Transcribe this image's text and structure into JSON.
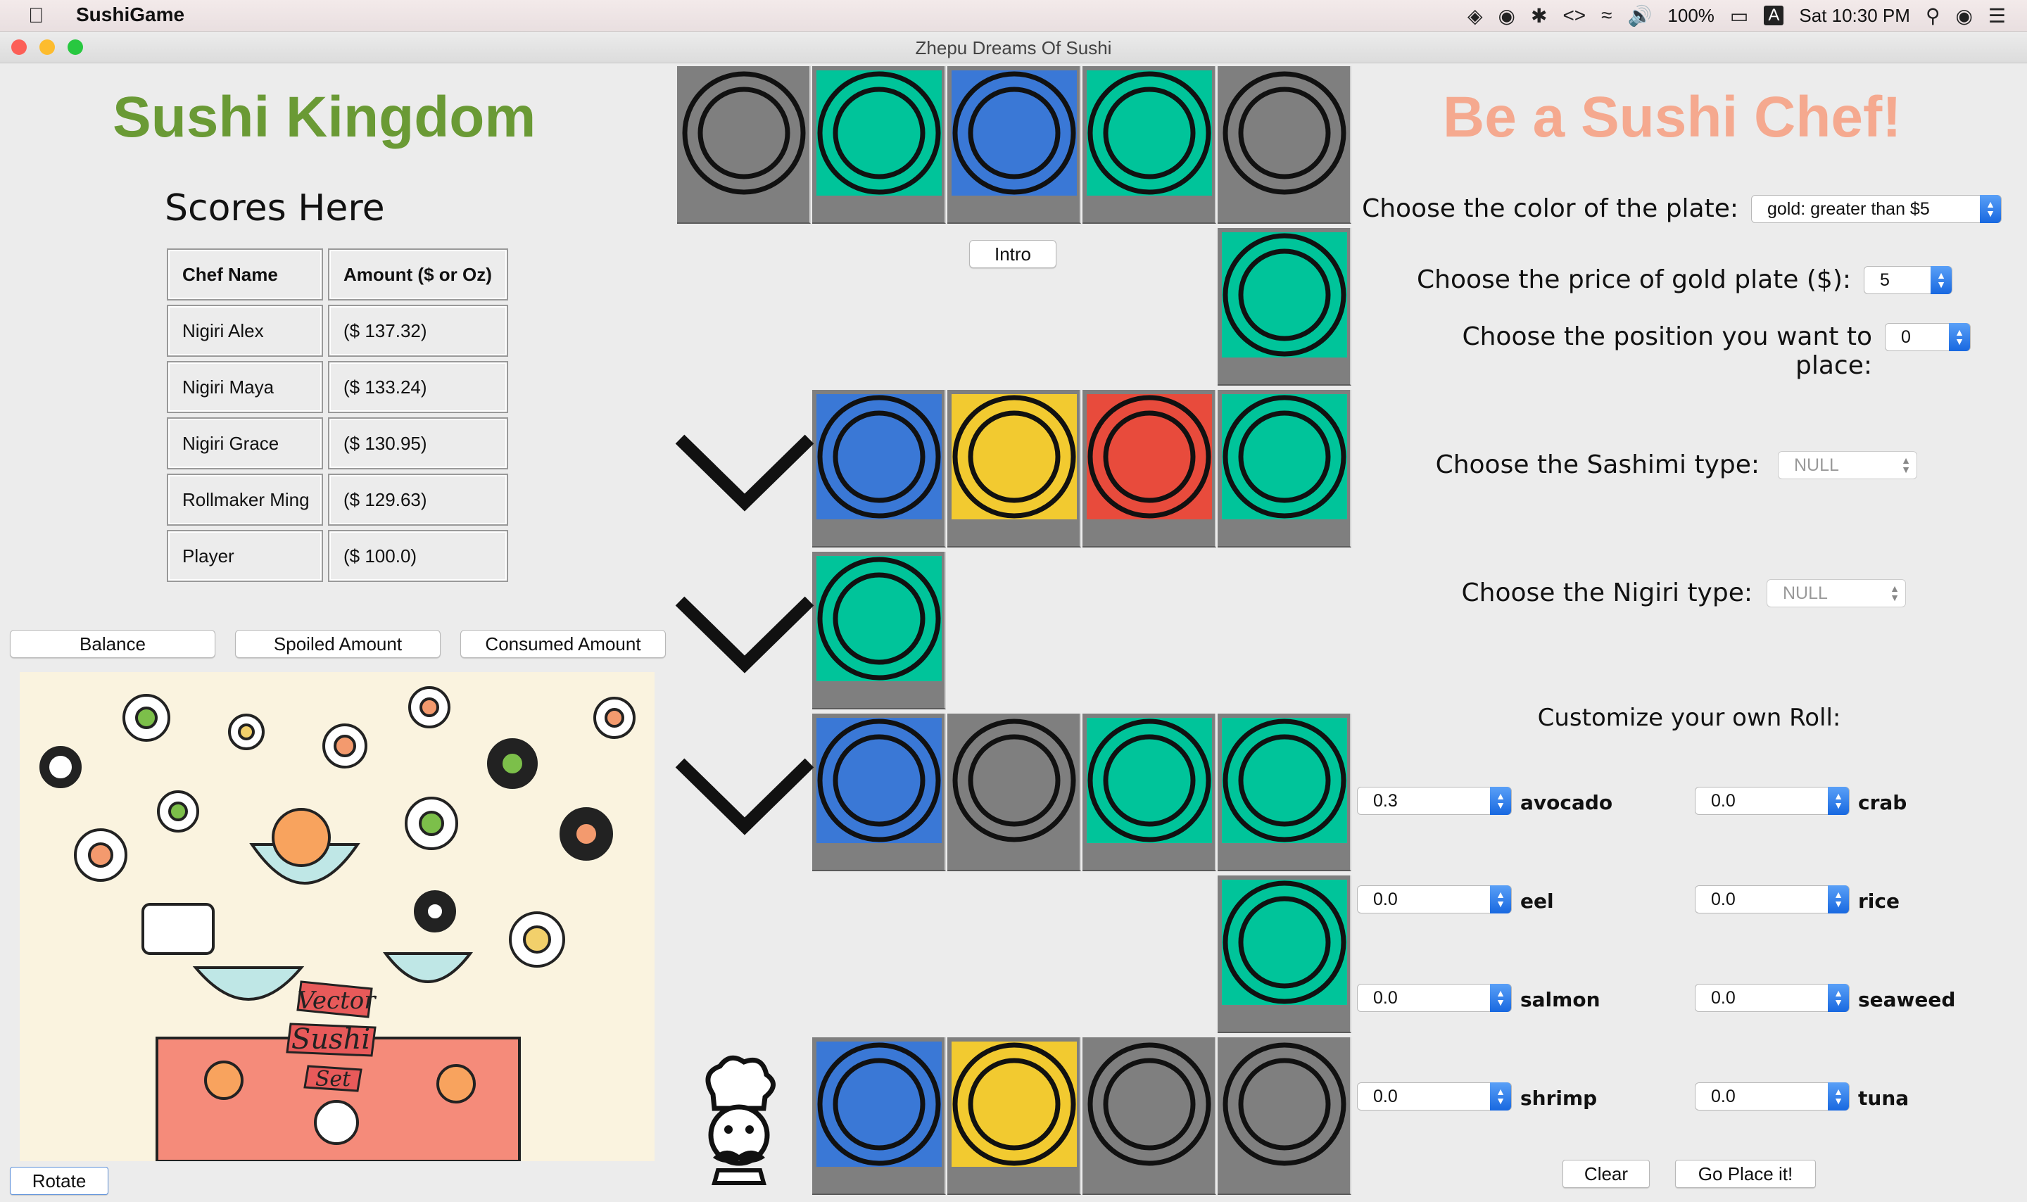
{
  "menubar": {
    "app_name": "SushiGame",
    "battery": "100%",
    "input_source": "A",
    "clock": "Sat 10:30 PM"
  },
  "window": {
    "title": "Zhepu Dreams Of Sushi"
  },
  "left": {
    "title": "Sushi Kingdom",
    "scores_title": "Scores Here",
    "table": {
      "headers": [
        "Chef Name",
        "Amount ($ or Oz)"
      ],
      "rows": [
        [
          "Nigiri Alex",
          "($ 137.32)"
        ],
        [
          "Nigiri Maya",
          "($ 133.24)"
        ],
        [
          "Nigiri Grace",
          "($ 130.95)"
        ],
        [
          "Rollmaker Ming",
          "($ 129.63)"
        ],
        [
          "Player",
          "($ 100.0)"
        ]
      ]
    },
    "buttons": {
      "balance": "Balance",
      "spoiled": "Spoiled Amount",
      "consumed": "Consumed Amount",
      "rotate": "Rotate"
    },
    "poster": {
      "line1": "Vector",
      "line2": "Sushi",
      "line3": "Set"
    }
  },
  "belt": {
    "intro_button": "Intro"
  },
  "colors": {
    "gray": "#7f7f7f",
    "green": "#00c49a",
    "blue": "#3a78d6",
    "yellow": "#f2ca30",
    "red": "#e84b3c"
  },
  "right": {
    "title": "Be a Sushi Chef!",
    "plate_color": {
      "label": "Choose the color of the plate:",
      "value": "gold: greater than $5"
    },
    "plate_price": {
      "label": "Choose the price of gold plate ($):",
      "value": "5"
    },
    "position": {
      "label": "Choose the position you want to place:",
      "value": "0"
    },
    "sashimi": {
      "label": "Choose the Sashimi type:",
      "value": "NULL"
    },
    "nigiri": {
      "label": "Choose the Nigiri type:",
      "value": "NULL"
    },
    "roll": {
      "title": "Customize your own Roll:",
      "ingredients": [
        {
          "name": "avocado",
          "value": "0.3"
        },
        {
          "name": "crab",
          "value": "0.0"
        },
        {
          "name": "eel",
          "value": "0.0"
        },
        {
          "name": "rice",
          "value": "0.0"
        },
        {
          "name": "salmon",
          "value": "0.0"
        },
        {
          "name": "seaweed",
          "value": "0.0"
        },
        {
          "name": "shrimp",
          "value": "0.0"
        },
        {
          "name": "tuna",
          "value": "0.0"
        }
      ]
    },
    "buttons": {
      "clear": "Clear",
      "place": "Go Place it!"
    }
  }
}
